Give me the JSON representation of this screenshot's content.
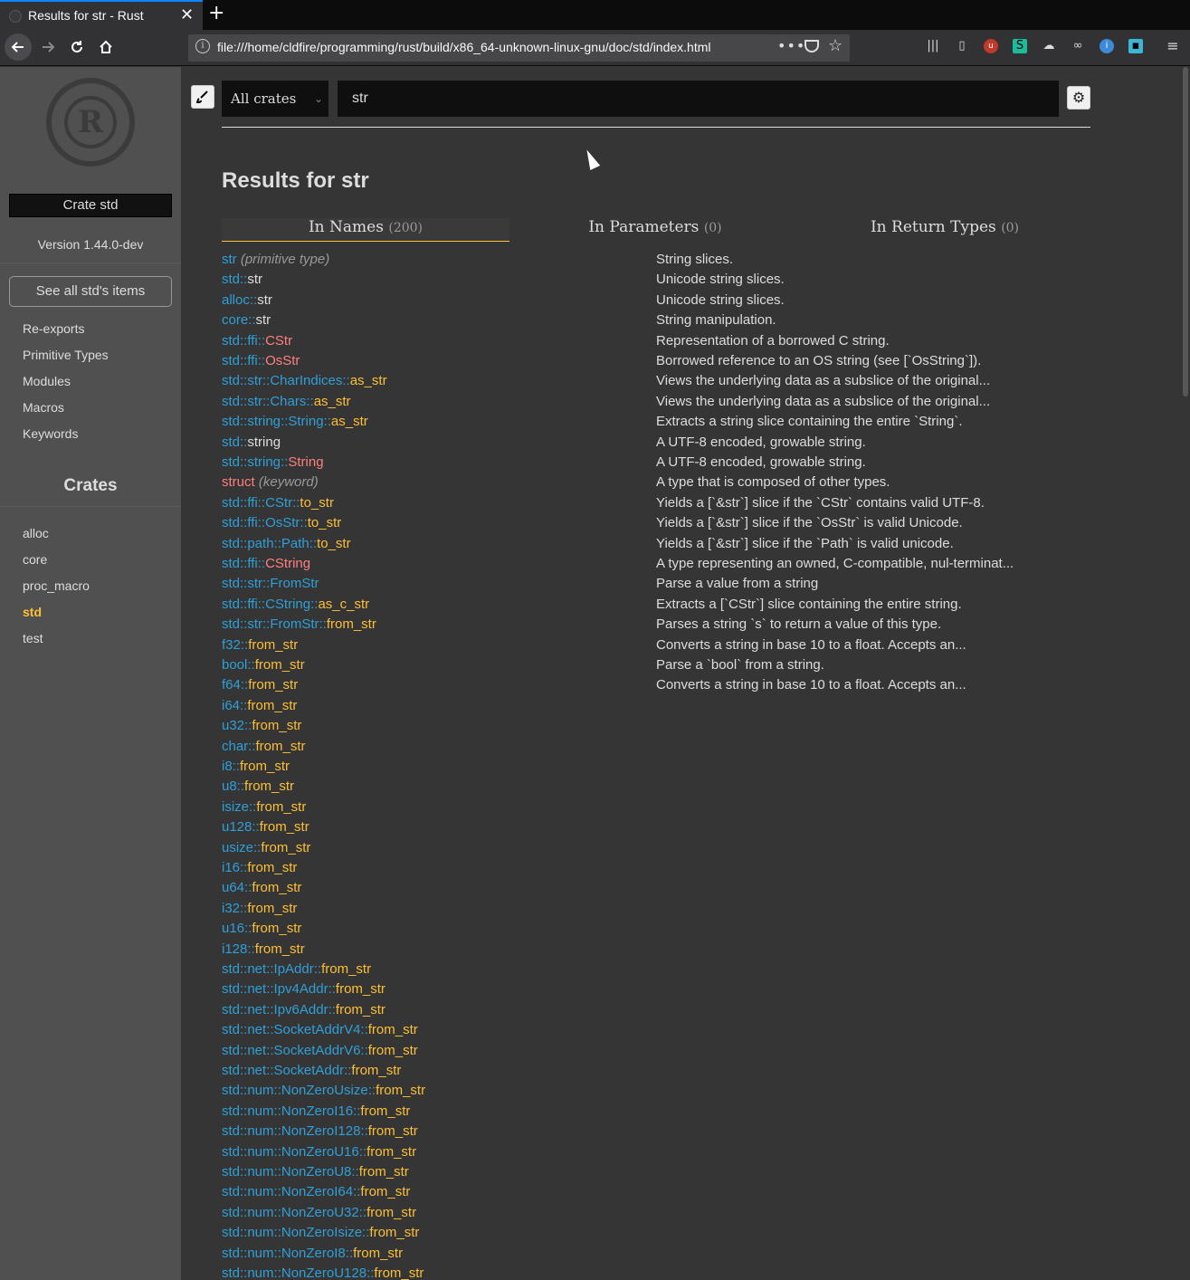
{
  "browser": {
    "tab_title": "Results for str - Rust",
    "tab_close": "✕",
    "new_tab": "+",
    "url": "file:///home/cldfire/programming/rust/build/x86_64-unknown-linux-gnu/doc/std/index.html",
    "url_more": "•••"
  },
  "sidebar": {
    "crate_name": "Crate std",
    "version": "Version 1.44.0-dev",
    "see_all": "See all std's items",
    "sections": [
      "Re-exports",
      "Primitive Types",
      "Modules",
      "Macros",
      "Keywords"
    ],
    "crates_title": "Crates",
    "crates": [
      "alloc",
      "core",
      "proc_macro",
      "std",
      "test"
    ],
    "current_crate": "std"
  },
  "search": {
    "crate_filter": "All crates",
    "query": "str",
    "results_title": "Results for str",
    "tabs": [
      {
        "label": "In Names",
        "count": "(200)"
      },
      {
        "label": "In Parameters",
        "count": "(0)"
      },
      {
        "label": "In Return Types",
        "count": "(0)"
      }
    ],
    "results": [
      {
        "path": "",
        "name": "str",
        "kind": "primitive",
        "tag": "(primitive type)",
        "desc": "String slices."
      },
      {
        "path": "std::",
        "name": "str",
        "kind": "mod",
        "desc": "Unicode string slices."
      },
      {
        "path": "alloc::",
        "name": "str",
        "kind": "mod",
        "desc": "Unicode string slices."
      },
      {
        "path": "core::",
        "name": "str",
        "kind": "mod",
        "desc": "String manipulation."
      },
      {
        "path": "std::ffi::",
        "name": "CStr",
        "kind": "struct",
        "desc": "Representation of a borrowed C string."
      },
      {
        "path": "std::ffi::",
        "name": "OsStr",
        "kind": "struct",
        "desc": "Borrowed reference to an OS string (see [`OsString`])."
      },
      {
        "path": "std::str::CharIndices::",
        "name": "as_str",
        "kind": "method",
        "desc": "Views the underlying data as a subslice of the original..."
      },
      {
        "path": "std::str::Chars::",
        "name": "as_str",
        "kind": "method",
        "desc": "Views the underlying data as a subslice of the original..."
      },
      {
        "path": "std::string::String::",
        "name": "as_str",
        "kind": "method",
        "desc": "Extracts a string slice containing the entire `String`."
      },
      {
        "path": "std::",
        "name": "string",
        "kind": "mod",
        "desc": "A UTF-8 encoded, growable string."
      },
      {
        "path": "std::string::",
        "name": "String",
        "kind": "struct",
        "desc": "A UTF-8 encoded, growable string."
      },
      {
        "path": "",
        "name": "struct",
        "kind": "keyword",
        "tag": "(keyword)",
        "desc": "A type that is composed of other types."
      },
      {
        "path": "std::ffi::CStr::",
        "name": "to_str",
        "kind": "method",
        "desc": "Yields a [`&str`] slice if the `CStr` contains valid UTF-8."
      },
      {
        "path": "std::ffi::OsStr::",
        "name": "to_str",
        "kind": "method",
        "desc": "Yields a [`&str`] slice if the `OsStr` is valid Unicode."
      },
      {
        "path": "std::path::Path::",
        "name": "to_str",
        "kind": "method",
        "desc": "Yields a [`&str`] slice if the `Path` is valid unicode."
      },
      {
        "path": "std::ffi::",
        "name": "CString",
        "kind": "struct",
        "desc": "A type representing an owned, C-compatible, nul-terminat..."
      },
      {
        "path": "std::str::",
        "name": "FromStr",
        "kind": "trait",
        "desc": "Parse a value from a string"
      },
      {
        "path": "std::ffi::CString::",
        "name": "as_c_str",
        "kind": "method",
        "desc": "Extracts a [`CStr`] slice containing the entire string."
      },
      {
        "path": "std::str::FromStr::",
        "name": "from_str",
        "kind": "method",
        "desc": "Parses a string `s` to return a value of this type."
      },
      {
        "path": "f32::",
        "name": "from_str",
        "kind": "method",
        "desc": "Converts a string in base 10 to a float. Accepts an..."
      },
      {
        "path": "bool::",
        "name": "from_str",
        "kind": "method",
        "desc": "Parse a `bool` from a string."
      },
      {
        "path": "f64::",
        "name": "from_str",
        "kind": "method",
        "desc": "Converts a string in base 10 to a float. Accepts an..."
      },
      {
        "path": "i64::",
        "name": "from_str",
        "kind": "method",
        "desc": ""
      },
      {
        "path": "u32::",
        "name": "from_str",
        "kind": "method",
        "desc": ""
      },
      {
        "path": "char::",
        "name": "from_str",
        "kind": "method",
        "desc": ""
      },
      {
        "path": "i8::",
        "name": "from_str",
        "kind": "method",
        "desc": ""
      },
      {
        "path": "u8::",
        "name": "from_str",
        "kind": "method",
        "desc": ""
      },
      {
        "path": "isize::",
        "name": "from_str",
        "kind": "method",
        "desc": ""
      },
      {
        "path": "u128::",
        "name": "from_str",
        "kind": "method",
        "desc": ""
      },
      {
        "path": "usize::",
        "name": "from_str",
        "kind": "method",
        "desc": ""
      },
      {
        "path": "i16::",
        "name": "from_str",
        "kind": "method",
        "desc": ""
      },
      {
        "path": "u64::",
        "name": "from_str",
        "kind": "method",
        "desc": ""
      },
      {
        "path": "i32::",
        "name": "from_str",
        "kind": "method",
        "desc": ""
      },
      {
        "path": "u16::",
        "name": "from_str",
        "kind": "method",
        "desc": ""
      },
      {
        "path": "i128::",
        "name": "from_str",
        "kind": "method",
        "desc": ""
      },
      {
        "path": "std::net::IpAddr::",
        "name": "from_str",
        "kind": "method",
        "desc": ""
      },
      {
        "path": "std::net::Ipv4Addr::",
        "name": "from_str",
        "kind": "method",
        "desc": ""
      },
      {
        "path": "std::net::Ipv6Addr::",
        "name": "from_str",
        "kind": "method",
        "desc": ""
      },
      {
        "path": "std::net::SocketAddrV4::",
        "name": "from_str",
        "kind": "method",
        "desc": ""
      },
      {
        "path": "std::net::SocketAddrV6::",
        "name": "from_str",
        "kind": "method",
        "desc": ""
      },
      {
        "path": "std::net::SocketAddr::",
        "name": "from_str",
        "kind": "method",
        "desc": ""
      },
      {
        "path": "std::num::NonZeroUsize::",
        "name": "from_str",
        "kind": "method",
        "desc": ""
      },
      {
        "path": "std::num::NonZeroI16::",
        "name": "from_str",
        "kind": "method",
        "desc": ""
      },
      {
        "path": "std::num::NonZeroI128::",
        "name": "from_str",
        "kind": "method",
        "desc": ""
      },
      {
        "path": "std::num::NonZeroU16::",
        "name": "from_str",
        "kind": "method",
        "desc": ""
      },
      {
        "path": "std::num::NonZeroU8::",
        "name": "from_str",
        "kind": "method",
        "desc": ""
      },
      {
        "path": "std::num::NonZeroI64::",
        "name": "from_str",
        "kind": "method",
        "desc": ""
      },
      {
        "path": "std::num::NonZeroU32::",
        "name": "from_str",
        "kind": "method",
        "desc": ""
      },
      {
        "path": "std::num::NonZeroIsize::",
        "name": "from_str",
        "kind": "method",
        "desc": ""
      },
      {
        "path": "std::num::NonZeroI8::",
        "name": "from_str",
        "kind": "method",
        "desc": ""
      },
      {
        "path": "std::num::NonZeroU128::",
        "name": "from_str",
        "kind": "method",
        "desc": ""
      }
    ]
  },
  "colors": {
    "page_bg": "#353535",
    "sidebar_bg": "#505050",
    "path": "#2f9fd8",
    "method": "#fdbf35",
    "struct": "#ff7f7f",
    "accent": "#fdbf35"
  },
  "icons": {
    "back": "back-arrow-icon",
    "forward": "forward-arrow-icon",
    "reload": "reload-icon",
    "home": "home-icon",
    "theme": "paintbrush-icon",
    "settings": "gear-icon"
  }
}
